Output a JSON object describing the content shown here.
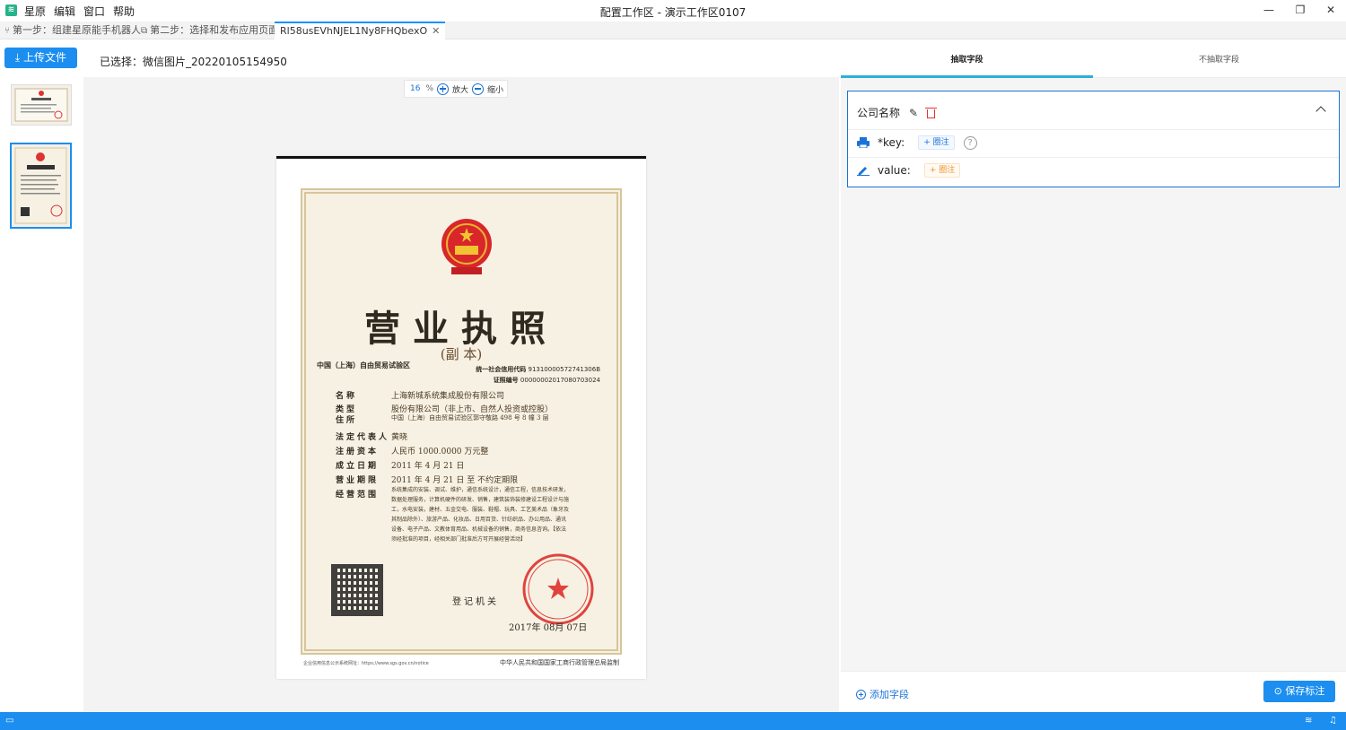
{
  "titlebar": {
    "menu": [
      "星原",
      "编辑",
      "窗口",
      "帮助"
    ],
    "window_title": "配置工作区 - 演示工作区0107"
  },
  "tabs": [
    {
      "label": "第一步：组建星原能手机器人"
    },
    {
      "label": "第二步：选择和发布应用页面"
    },
    {
      "label": "Rl58usEVhNJEL1Ny8FHQbexO"
    }
  ],
  "toolbar": {
    "upload_label": "上传文件",
    "selected_label": "已选择：微信图片_20220105154950"
  },
  "zoom": {
    "value": "16",
    "unit": "%",
    "zoom_in_label": "放大",
    "zoom_out_label": "缩小"
  },
  "document": {
    "title": "营业执照",
    "subtitle": "(副  本)",
    "region": "中国（上海）自由贸易试验区",
    "credit_code_label": "统一社会信用代码",
    "credit_code": "91310000572741306B",
    "cert_no_label": "证照编号",
    "cert_no": "00000002017080703024",
    "rows": [
      {
        "k": "名称",
        "v": "上海新城系统集成股份有限公司"
      },
      {
        "k": "类型",
        "v": "股份有限公司（非上市、自然人投资或控股）"
      },
      {
        "k": "住所",
        "v": "中国（上海）自由贸易试验区郭守敬路 498 号 8 幢 3 层"
      },
      {
        "k": "法定代表人",
        "v": "黄晓"
      },
      {
        "k": "注册资本",
        "v": "人民币 1000.0000 万元整"
      },
      {
        "k": "成立日期",
        "v": "2011 年 4 月 21 日"
      },
      {
        "k": "营业期限",
        "v": "2011 年 4 月 21 日  至  不约定期限"
      },
      {
        "k": "经营范围",
        "v": ""
      }
    ],
    "scope": "系统集成的安装、调试、维护，通信系统设计，通信工程，信息技术研发，数据处理服务，计算机硬件的研发、销售，建筑装饰装修建设工程设计与施工，水电安装，建材、五金交电、服装、鞋帽、玩具、工艺美术品（象牙及其制品除外）、旅游产品、化妆品、日用百货、针纺织品、办公用品、通讯设备、电子产品、文教体育用品、机械设备的销售，商务信息咨询。【依法须经批准的项目，经相关部门批准后方可开展经营活动】",
    "org": "登记机关",
    "date": "2017年 08月 07日",
    "footer_left": "企业信用信息公示系统网址：https://www.sgs.gov.cn/notice",
    "footer_right": "中华人民共和国国家工商行政管理总局监制"
  },
  "right_panel": {
    "tab_extract": "抽取字段",
    "tab_no_extract": "不抽取字段",
    "field": {
      "name": "公司名称",
      "key_label": "*key:",
      "key_tag": "+ 圈注",
      "value_label": "value:",
      "value_tag": "+ 圈注"
    },
    "add_field_label": "添加字段",
    "save_label": "保存标注"
  },
  "colors": {
    "accent": "#1b8ef0",
    "card_border": "#1b73d8",
    "tab_indicator": "#2ab0d6",
    "delete": "#e5322d",
    "value_tag": "#f0962a"
  }
}
